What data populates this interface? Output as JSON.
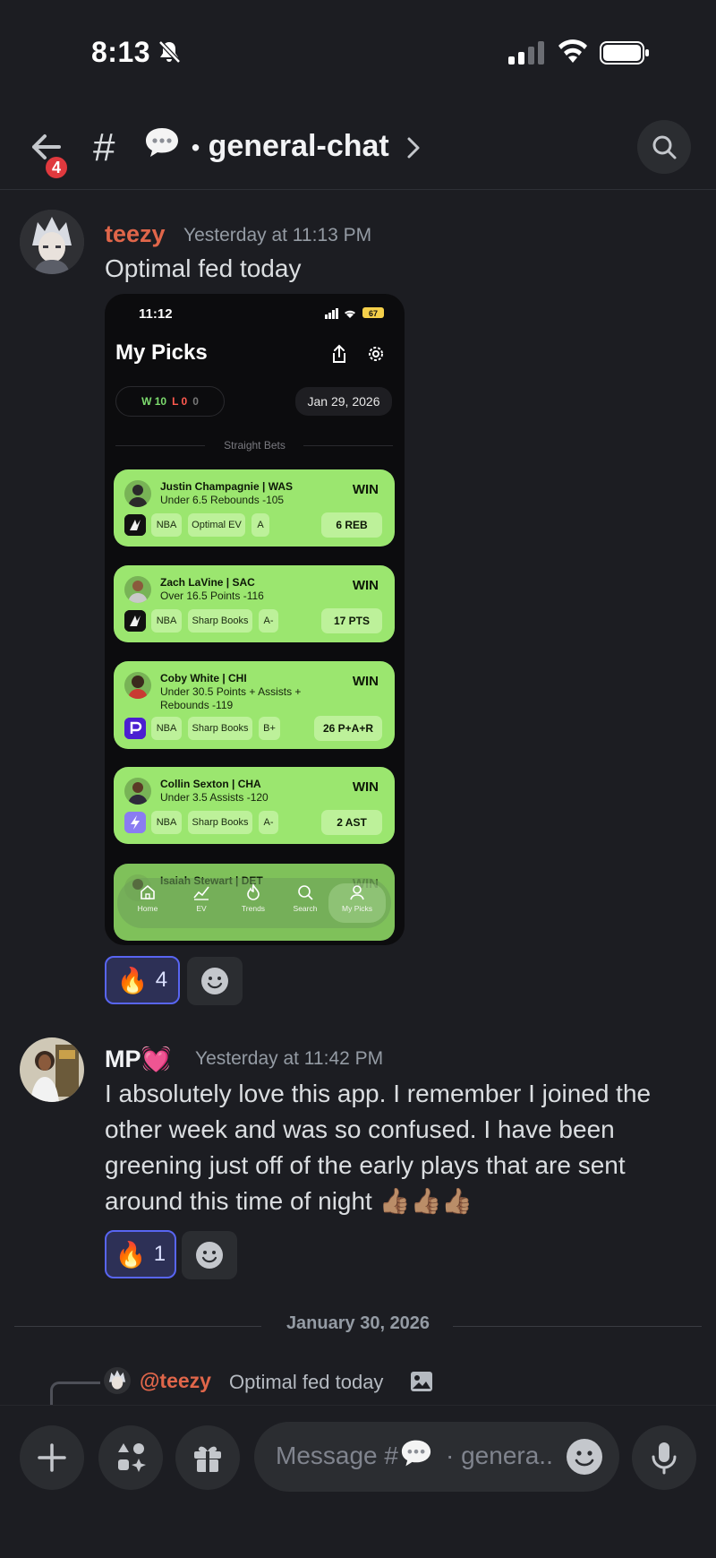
{
  "status_bar": {
    "time": "8:13"
  },
  "header": {
    "back_badge": "4",
    "channel_hash": "#",
    "channel_name": "general-chat"
  },
  "messages": [
    {
      "username": "teezy",
      "username_color": "#e0664a",
      "timestamp": "Yesterday at 11:13 PM",
      "text": "Optimal fed today",
      "attachment": {
        "time": "11:12",
        "battery": "67",
        "title": "My Picks",
        "record": {
          "wins": "W 10",
          "losses": "L 0",
          "pushes": "0"
        },
        "date": "Jan 29, 2026",
        "section_label": "Straight Bets",
        "picks": [
          {
            "player": "Justin Champagnie | WAS",
            "line": "Under 6.5 Rebounds -105",
            "result": "WIN",
            "league": "NBA",
            "source": "Optimal EV",
            "grade": "A",
            "stat": "6 REB"
          },
          {
            "player": "Zach LaVine | SAC",
            "line": "Over 16.5 Points -116",
            "result": "WIN",
            "league": "NBA",
            "source": "Sharp Books",
            "grade": "A-",
            "stat": "17 PTS"
          },
          {
            "player": "Coby White | CHI",
            "line": "Under 30.5 Points + Assists + Rebounds -119",
            "result": "WIN",
            "league": "NBA",
            "source": "Sharp Books",
            "grade": "B+",
            "stat": "26 P+A+R"
          },
          {
            "player": "Collin Sexton | CHA",
            "line": "Under 3.5 Assists -120",
            "result": "WIN",
            "league": "NBA",
            "source": "Sharp Books",
            "grade": "A-",
            "stat": "2 AST"
          },
          {
            "player": "Isaiah Stewart | DET",
            "line": "",
            "result": "WIN",
            "league": "",
            "source": "",
            "grade": "",
            "stat": ""
          }
        ],
        "tabs": [
          "Home",
          "EV",
          "Trends",
          "Search",
          "My Picks"
        ]
      },
      "reaction": {
        "emoji": "🔥",
        "count": "4"
      }
    },
    {
      "username": "MP💓",
      "username_color": "#f2f3f5",
      "timestamp": "Yesterday at 11:42 PM",
      "text": "I absolutely love this app. I remember I joined the other week and was so confused. I have been greening just off of the early plays that are sent around this time of night 👍🏽👍🏽👍🏽",
      "reaction": {
        "emoji": "🔥",
        "count": "1"
      }
    }
  ],
  "date_divider": "January 30, 2026",
  "reply_preview": {
    "mention": "@teezy",
    "text": "Optimal fed today"
  },
  "composer": {
    "placeholder_prefix": "Message #",
    "placeholder_suffix": "· genera.."
  },
  "colors": {
    "background": "#1c1d22",
    "win_card": "#9be66f",
    "reaction_active": "#5865f2",
    "badge": "#e0393e"
  },
  "icons": [
    "bell-slash-icon",
    "back-arrow-icon",
    "speech-bubble-icon",
    "chevron-right-icon",
    "search-icon",
    "fire-icon",
    "add-reaction-icon",
    "image-icon",
    "plus-icon",
    "apps-icon",
    "gift-icon",
    "emoji-icon",
    "microphone-icon"
  ]
}
